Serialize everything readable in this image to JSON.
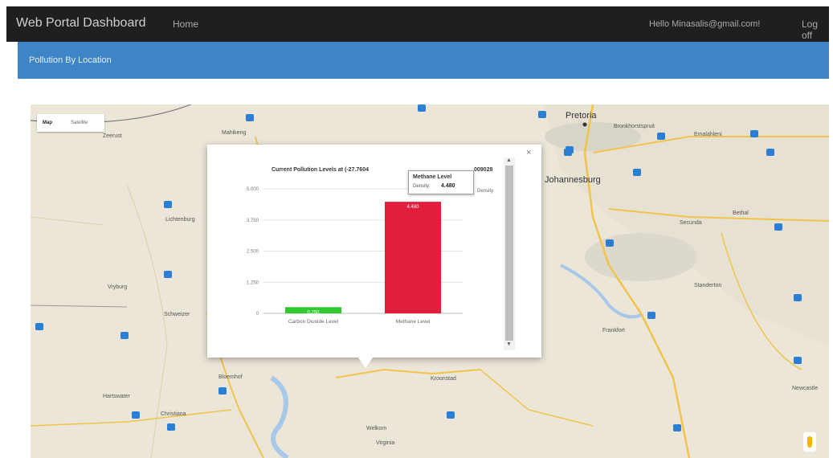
{
  "header": {
    "brand": "Web Portal Dashboard",
    "nav_home": "Home",
    "user": "Hello Minasalis@gmail.com!",
    "logoff": "Log off"
  },
  "panel": {
    "title": "Pollution By Location"
  },
  "map": {
    "toggle_map": "Map",
    "toggle_satellite": "Satellite",
    "places": {
      "pretoria": "Pretoria",
      "johannesburg": "Johannesburg",
      "mahikeng": "Mahikeng",
      "welkom": "Welkom",
      "virginia": "Virginia",
      "kroonstad": "Kroonstad",
      "vryburg": "Vryburg",
      "bronkhorstspruit": "Bronkhorstspruit",
      "emalahleni": "Emalahleni",
      "bethal": "Bethal",
      "secunda": "Secunda",
      "standerton": "Standerton",
      "frankfort": "Frankfort",
      "schweizer": "Schweizer",
      "bloemhof": "Bloemhof",
      "newcastle": "Newcastle",
      "lichtenburg": "Lichtenburg",
      "zeerust": "Zeerust",
      "christiana": "Christiana",
      "hartswater": "Hartswater"
    }
  },
  "popup": {
    "close": "×",
    "title": "Current Pollution Levels at (-27.7604",
    "title_end": "009028",
    "side_label": "Density",
    "scroll_up": "▲",
    "scroll_down": "▼",
    "tooltip": {
      "title": "Methane Level",
      "label": "Density:",
      "value": "4.480"
    }
  },
  "chart_data": {
    "type": "bar",
    "title": "Current Pollution Levels at (-27.7604",
    "categories": [
      "Carbon Dioxide Level",
      "Methane Level"
    ],
    "values": [
      0.25,
      4.48
    ],
    "data_labels": [
      "0.250",
      "4.480"
    ],
    "colors": [
      "#32c832",
      "#e01f3d"
    ],
    "y_ticks": [
      "0",
      "1.250",
      "2.500",
      "3.750",
      "5.000"
    ],
    "ylim": [
      0,
      5
    ],
    "grid": true,
    "xlabel": "",
    "ylabel": ""
  }
}
